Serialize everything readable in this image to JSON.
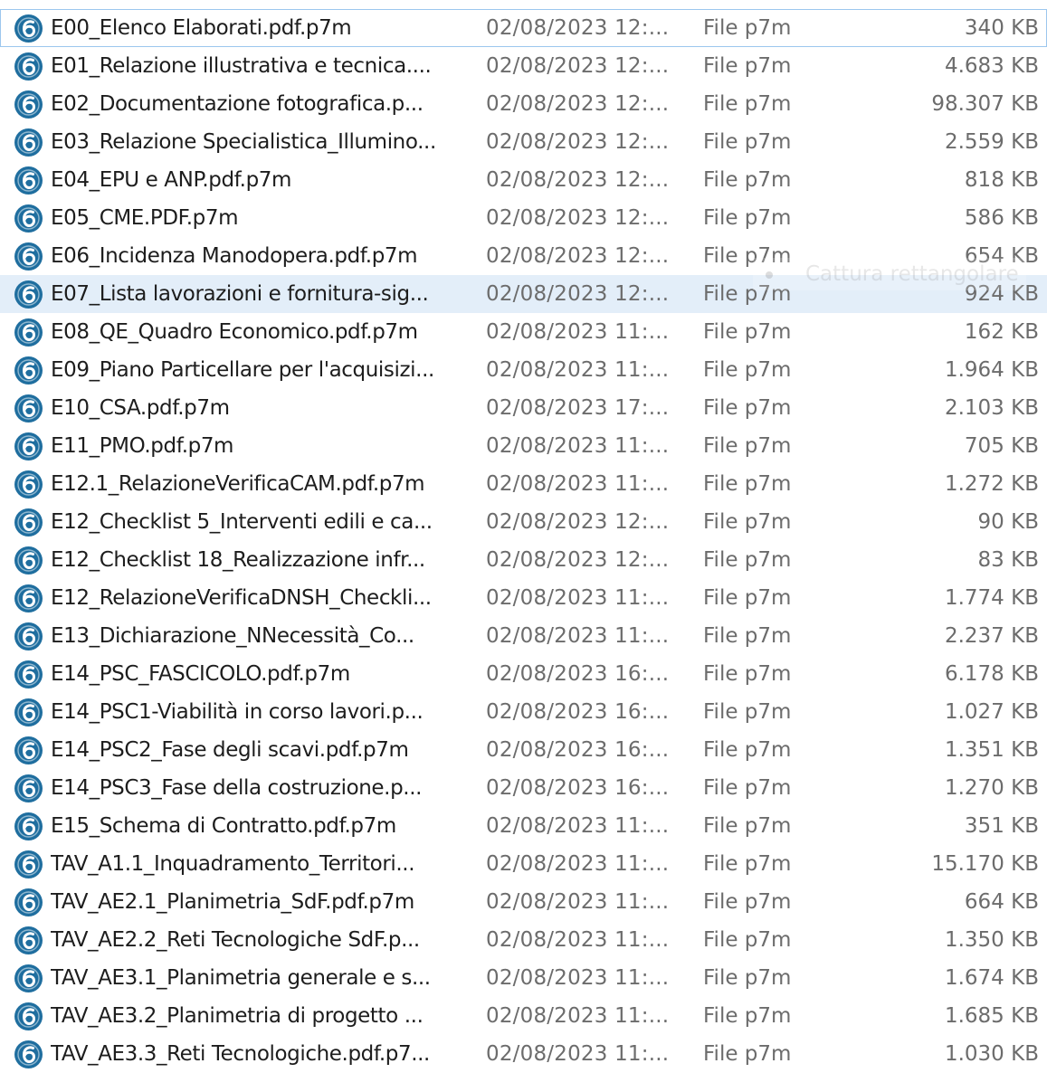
{
  "file_icon": {
    "name": "pdf-signed-file-icon",
    "color": "#1f6e9f"
  },
  "colors": {
    "selected_row": "#e3eef9",
    "focus_border": "#9cc7ee"
  },
  "overlay": {
    "label": "Cattura rettangolare"
  },
  "files": [
    {
      "name": "E00_Elenco Elaborati.pdf.p7m",
      "date": "02/08/2023 12:...",
      "type": "File p7m",
      "size": "340 KB"
    },
    {
      "name": "E01_Relazione illustrativa e tecnica....",
      "date": "02/08/2023 12:...",
      "type": "File p7m",
      "size": "4.683 KB"
    },
    {
      "name": "E02_Documentazione fotografica.p...",
      "date": "02/08/2023 12:...",
      "type": "File p7m",
      "size": "98.307 KB"
    },
    {
      "name": "E03_Relazione Specialistica_Illumino...",
      "date": "02/08/2023 12:...",
      "type": "File p7m",
      "size": "2.559 KB"
    },
    {
      "name": "E04_EPU e ANP.pdf.p7m",
      "date": "02/08/2023 12:...",
      "type": "File p7m",
      "size": "818 KB"
    },
    {
      "name": "E05_CME.PDF.p7m",
      "date": "02/08/2023 12:...",
      "type": "File p7m",
      "size": "586 KB"
    },
    {
      "name": "E06_Incidenza Manodopera.pdf.p7m",
      "date": "02/08/2023 12:...",
      "type": "File p7m",
      "size": "654 KB"
    },
    {
      "name": "E07_Lista lavorazioni e fornitura-sig...",
      "date": "02/08/2023 12:...",
      "type": "File p7m",
      "size": "924 KB"
    },
    {
      "name": "E08_QE_Quadro Economico.pdf.p7m",
      "date": "02/08/2023 11:...",
      "type": "File p7m",
      "size": "162 KB"
    },
    {
      "name": "E09_Piano Particellare per l'acquisizi...",
      "date": "02/08/2023 11:...",
      "type": "File p7m",
      "size": "1.964 KB"
    },
    {
      "name": "E10_CSA.pdf.p7m",
      "date": "02/08/2023 17:...",
      "type": "File p7m",
      "size": "2.103 KB"
    },
    {
      "name": "E11_PMO.pdf.p7m",
      "date": "02/08/2023 11:...",
      "type": "File p7m",
      "size": "705 KB"
    },
    {
      "name": "E12.1_RelazioneVerificaCAM.pdf.p7m",
      "date": "02/08/2023 11:...",
      "type": "File p7m",
      "size": "1.272 KB"
    },
    {
      "name": "E12_Checklist 5_Interventi edili e ca...",
      "date": "02/08/2023 12:...",
      "type": "File p7m",
      "size": "90 KB"
    },
    {
      "name": "E12_Checklist 18_Realizzazione infr...",
      "date": "02/08/2023 12:...",
      "type": "File p7m",
      "size": "83 KB"
    },
    {
      "name": "E12_RelazioneVerificaDNSH_Checkli...",
      "date": "02/08/2023 11:...",
      "type": "File p7m",
      "size": "1.774 KB"
    },
    {
      "name": "E13_Dichiarazione_NNecessità_Co...",
      "date": "02/08/2023 11:...",
      "type": "File p7m",
      "size": "2.237 KB"
    },
    {
      "name": "E14_PSC_FASCICOLO.pdf.p7m",
      "date": "02/08/2023 16:...",
      "type": "File p7m",
      "size": "6.178 KB"
    },
    {
      "name": "E14_PSC1-Viabilità in corso lavori.p...",
      "date": "02/08/2023 16:...",
      "type": "File p7m",
      "size": "1.027 KB"
    },
    {
      "name": "E14_PSC2_Fase degli scavi.pdf.p7m",
      "date": "02/08/2023 16:...",
      "type": "File p7m",
      "size": "1.351 KB"
    },
    {
      "name": "E14_PSC3_Fase della costruzione.p...",
      "date": "02/08/2023 16:...",
      "type": "File p7m",
      "size": "1.270 KB"
    },
    {
      "name": "E15_Schema di Contratto.pdf.p7m",
      "date": "02/08/2023 11:...",
      "type": "File p7m",
      "size": "351 KB"
    },
    {
      "name": "TAV_A1.1_Inquadramento_Territori...",
      "date": "02/08/2023 11:...",
      "type": "File p7m",
      "size": "15.170 KB"
    },
    {
      "name": "TAV_AE2.1_Planimetria_SdF.pdf.p7m",
      "date": "02/08/2023 11:...",
      "type": "File p7m",
      "size": "664 KB"
    },
    {
      "name": "TAV_AE2.2_Reti Tecnologiche SdF.p...",
      "date": "02/08/2023 11:...",
      "type": "File p7m",
      "size": "1.350 KB"
    },
    {
      "name": "TAV_AE3.1_Planimetria generale e s...",
      "date": "02/08/2023 11:...",
      "type": "File p7m",
      "size": "1.674 KB"
    },
    {
      "name": "TAV_AE3.2_Planimetria di progetto ...",
      "date": "02/08/2023 11:...",
      "type": "File p7m",
      "size": "1.685 KB"
    },
    {
      "name": "TAV_AE3.3_Reti Tecnologiche.pdf.p7...",
      "date": "02/08/2023 11:...",
      "type": "File p7m",
      "size": "1.030 KB"
    }
  ]
}
